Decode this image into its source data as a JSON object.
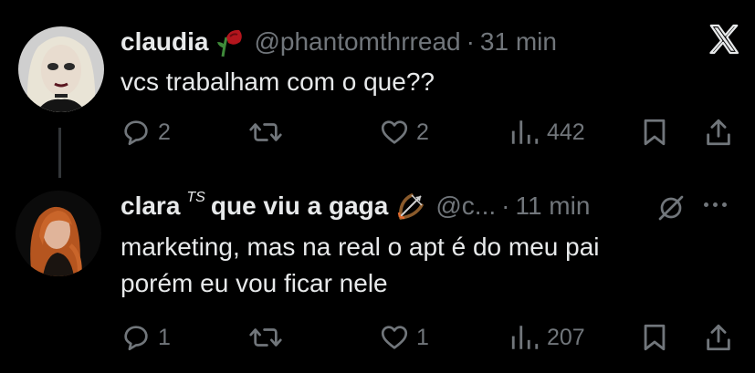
{
  "posts": [
    {
      "name": "claudia",
      "handle": "@phantomthrread",
      "separator": "·",
      "time": "31 min",
      "text": [
        "vcs trabalham com o que??"
      ],
      "emoji": "wilted-rose",
      "actions": {
        "replies": "2",
        "reposts": "",
        "likes": "2",
        "views": "442"
      }
    },
    {
      "name": "clara",
      "name_super": "TS",
      "name_rest": "que viu a gaga",
      "handle": "@c...",
      "separator": "·",
      "time": "11 min",
      "text": [
        "marketing, mas na real o apt é do meu pai",
        "porém eu vou ficar nele"
      ],
      "emoji": "bow-and-arrow",
      "actions": {
        "replies": "1",
        "reposts": "",
        "likes": "1",
        "views": "207"
      }
    }
  ],
  "icons": {
    "reply": "comment-icon",
    "repost": "repost-icon",
    "like": "heart-icon",
    "views": "views-icon",
    "bookmark": "bookmark-icon",
    "share": "share-icon",
    "logo": "x-logo-icon",
    "mute": "mute-icon",
    "more": "more-icon"
  },
  "colors": {
    "background": "#000000",
    "text_primary": "#e7e9ea",
    "text_secondary": "#71767b",
    "thread_line": "#333639"
  }
}
